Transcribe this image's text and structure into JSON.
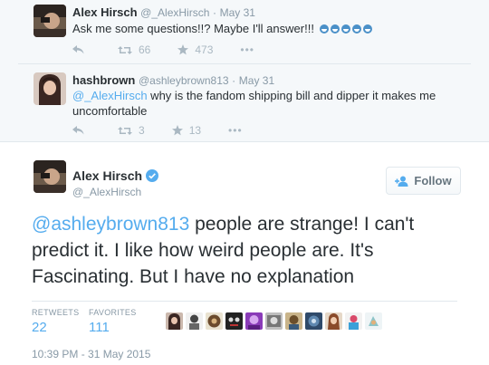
{
  "tweet1": {
    "name": "Alex Hirsch",
    "handle": "@_AlexHirsch",
    "time": "May 31",
    "text": "Ask me some questions!!? Maybe I'll answer!!!",
    "emoji_count": 5,
    "retweets": "66",
    "favorites": "473"
  },
  "tweet2": {
    "name": "hashbrown",
    "handle": "@ashleybrown813",
    "time": "May 31",
    "mention": "@_AlexHirsch",
    "text": " why is the fandom shipping bill and dipper it makes me uncomfortable",
    "retweets": "3",
    "favorites": "13"
  },
  "main": {
    "name": "Alex Hirsch",
    "handle": "@_AlexHirsch",
    "follow_label": "Follow",
    "mention": "@ashleybrown813",
    "text": " people are strange! I can't predict it. I like how weird people are. It's Fascinating. But I have no explanation",
    "retweets_label": "RETWEETS",
    "retweets": "22",
    "favorites_label": "FAVORITES",
    "favorites": "111",
    "timestamp": "10:39 PM - 31 May 2015"
  },
  "colors": {
    "accent": "#55acee",
    "muted": "#8899a6",
    "verified": "#55acee"
  },
  "icons": {
    "reply": "reply-icon",
    "retweet": "retweet-icon",
    "favorite": "star-icon",
    "more": "more-icon",
    "verified": "verified-badge-icon",
    "follow": "add-user-icon"
  }
}
